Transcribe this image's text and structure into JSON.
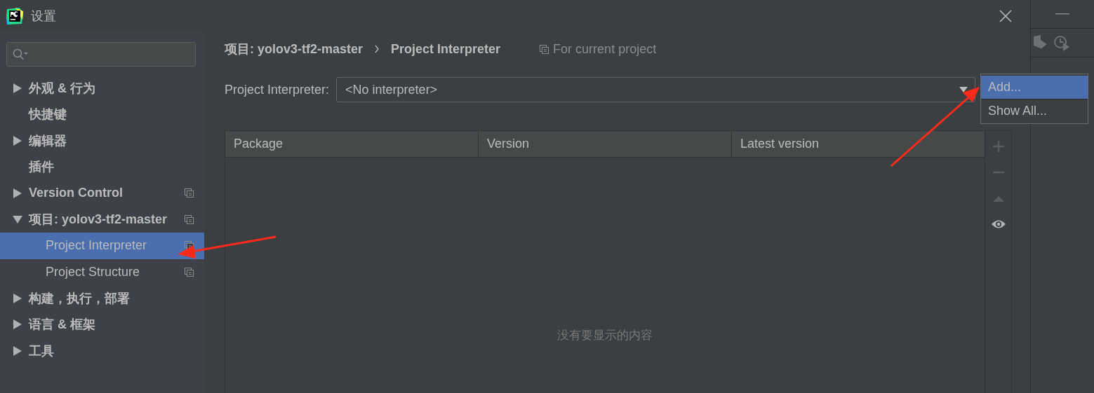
{
  "window": {
    "title": "设置"
  },
  "sidebar": {
    "items": [
      {
        "label": "外观 & 行为",
        "expanded": false,
        "selected": false,
        "project_scoped": false
      },
      {
        "label": "快捷键",
        "selected": false,
        "project_scoped": false
      },
      {
        "label": "编辑器",
        "expanded": false,
        "selected": false,
        "project_scoped": false
      },
      {
        "label": "插件",
        "selected": false,
        "project_scoped": false
      },
      {
        "label": "Version Control",
        "expanded": false,
        "selected": false,
        "project_scoped": true
      },
      {
        "label": "项目: yolov3-tf2-master",
        "expanded": true,
        "selected": false,
        "project_scoped": true,
        "children": [
          {
            "label": "Project Interpreter",
            "selected": true,
            "project_scoped": true
          },
          {
            "label": "Project Structure",
            "selected": false,
            "project_scoped": true
          }
        ]
      },
      {
        "label": "构建，执行，部署",
        "expanded": false,
        "selected": false,
        "project_scoped": false
      },
      {
        "label": "语言 & 框架",
        "expanded": false,
        "selected": false,
        "project_scoped": false
      },
      {
        "label": "工具",
        "expanded": false,
        "selected": false,
        "project_scoped": false
      }
    ]
  },
  "breadcrumb": [
    "项目: yolov3-tf2-master",
    "Project Interpreter"
  ],
  "scope_note": "For current project",
  "interpreter": {
    "label": "Project Interpreter:",
    "value": "<No interpreter>"
  },
  "menu": [
    {
      "label": "Add...",
      "selected": true
    },
    {
      "label": "Show All...",
      "selected": false
    }
  ],
  "table": {
    "columns": [
      "Package",
      "Version",
      "Latest version"
    ],
    "empty_text": "没有要显示的内容"
  }
}
